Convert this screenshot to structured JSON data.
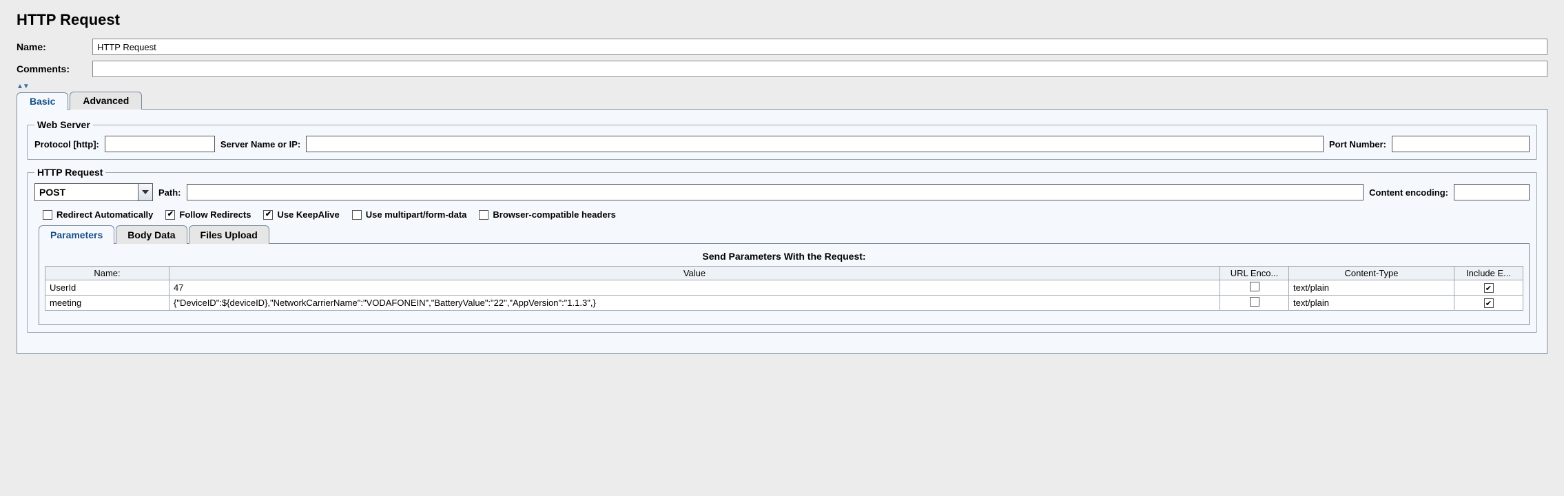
{
  "page": {
    "title": "HTTP Request",
    "name_label": "Name:",
    "name_value": "HTTP Request",
    "comments_label": "Comments:",
    "comments_value": ""
  },
  "tabs": {
    "basic": "Basic",
    "advanced": "Advanced"
  },
  "webserver": {
    "legend": "Web Server",
    "protocol_label": "Protocol [http]:",
    "protocol_value": "",
    "server_label": "Server Name or IP:",
    "server_value": "",
    "port_label": "Port Number:",
    "port_value": ""
  },
  "httpreq": {
    "legend": "HTTP Request",
    "method": "POST",
    "path_label": "Path:",
    "path_value": "",
    "encoding_label": "Content encoding:",
    "encoding_value": ""
  },
  "checks": {
    "redirect_auto": {
      "label": "Redirect Automatically",
      "checked": false
    },
    "follow_redirects": {
      "label": "Follow Redirects",
      "checked": true
    },
    "keepalive": {
      "label": "Use KeepAlive",
      "checked": true
    },
    "multipart": {
      "label": "Use multipart/form-data",
      "checked": false
    },
    "browser_compat": {
      "label": "Browser-compatible headers",
      "checked": false
    }
  },
  "inner_tabs": {
    "parameters": "Parameters",
    "body": "Body Data",
    "files": "Files Upload"
  },
  "param_table": {
    "caption": "Send Parameters With the Request:",
    "headers": {
      "name": "Name:",
      "value": "Value",
      "url_encode": "URL Enco...",
      "content_type": "Content-Type",
      "include_equals": "Include E..."
    },
    "rows": [
      {
        "name": "UserId",
        "value": "47",
        "url_encode": false,
        "content_type": "text/plain",
        "include_equals": true
      },
      {
        "name": "meeting",
        "value": "{\"DeviceID\":${deviceID},\"NetworkCarrierName\":\"VODAFONEIN\",\"BatteryValue\":\"22\",\"AppVersion\":\"1.1.3\",}",
        "url_encode": false,
        "content_type": "text/plain",
        "include_equals": true
      }
    ]
  }
}
